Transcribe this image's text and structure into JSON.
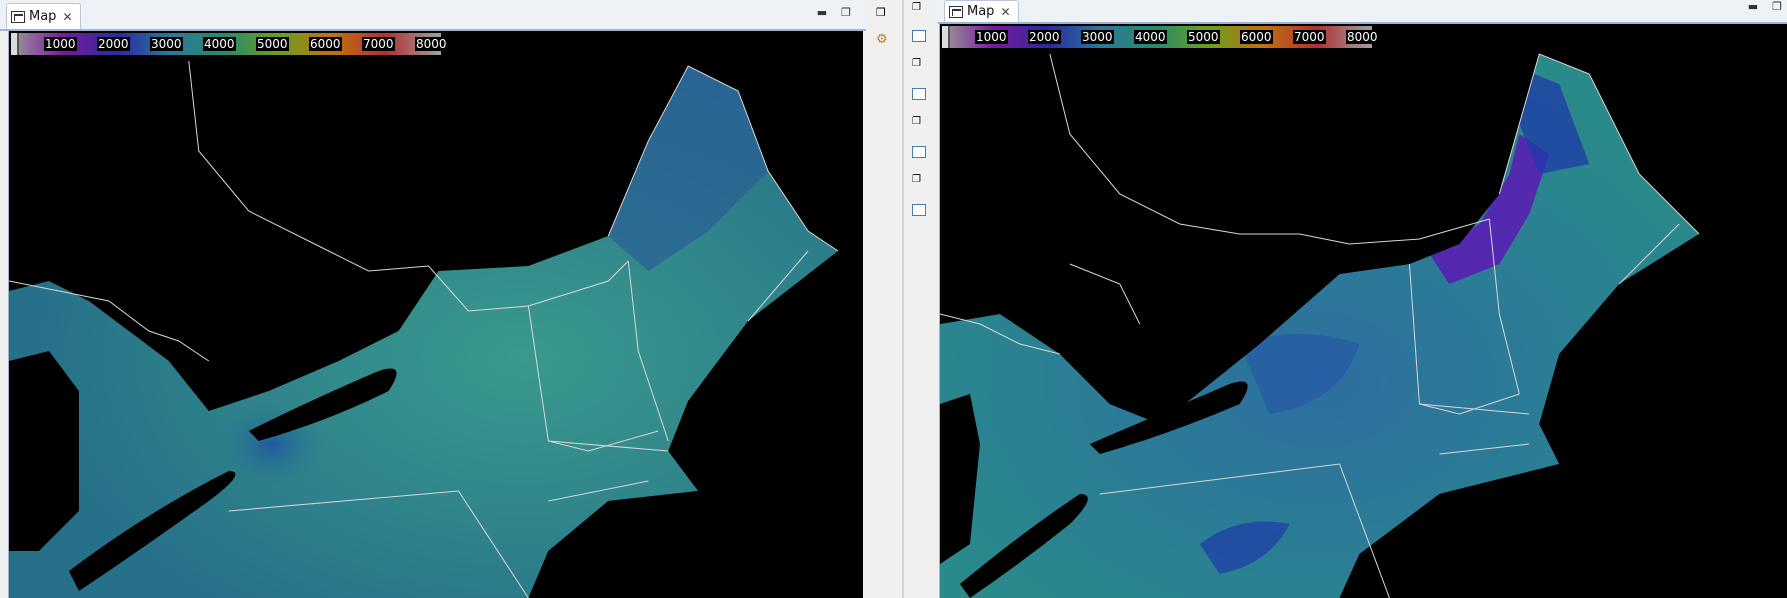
{
  "left_view": {
    "tab_label": "Map",
    "colorbar_ticks": [
      "1000",
      "2000",
      "3000",
      "4000",
      "5000",
      "6000",
      "7000",
      "8000"
    ]
  },
  "right_view": {
    "tab_label": "Map",
    "colorbar_ticks": [
      "1000",
      "2000",
      "3000",
      "4000",
      "5000",
      "6000",
      "7000",
      "8000"
    ]
  },
  "colors": {
    "map_background": "#000000",
    "boundary_lines": "#d8d8d8",
    "field_low_blue": "#1a3aa0",
    "field_mid_teal": "#2e8a8a",
    "field_purple": "#5a1ab4"
  },
  "icons": {
    "tab_icon": "map-view-icon",
    "close": "close-icon",
    "minimize": "minimize-icon",
    "restore": "restore-icon"
  }
}
